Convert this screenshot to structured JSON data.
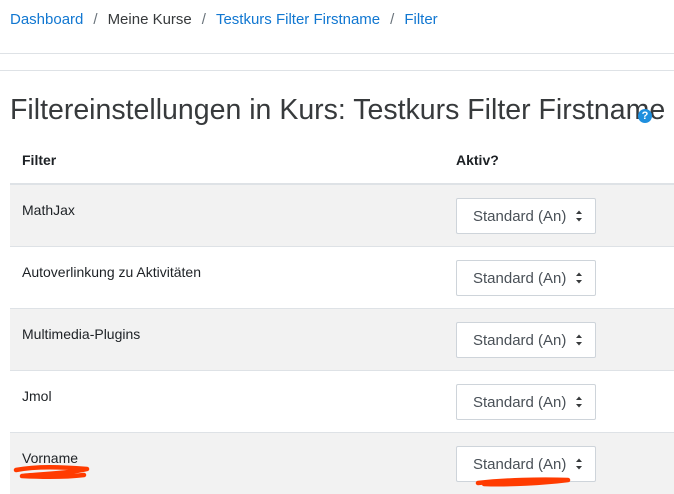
{
  "breadcrumb": {
    "items": [
      {
        "label": "Dashboard",
        "link": true
      },
      {
        "label": "Meine Kurse",
        "link": false
      },
      {
        "label": "Testkurs Filter Firstname",
        "link": true
      },
      {
        "label": "Filter",
        "link": true
      }
    ],
    "separator": "/"
  },
  "page_title": "Filtereinstellungen in Kurs: Testkurs Filter Firstname",
  "help_icon": "question-circle-icon",
  "table": {
    "headers": {
      "filter": "Filter",
      "active": "Aktiv?"
    },
    "rows": [
      {
        "name": "MathJax",
        "value": "Standard (An)"
      },
      {
        "name": "Autoverlinkung zu Aktivitäten",
        "value": "Standard (An)"
      },
      {
        "name": "Multimedia-Plugins",
        "value": "Standard (An)"
      },
      {
        "name": "Jmol",
        "value": "Standard (An)"
      },
      {
        "name": "Vorname",
        "value": "Standard (An)"
      }
    ]
  },
  "colors": {
    "link": "#1177d1",
    "annotation": "#ff3b00",
    "row_shade": "#f2f2f2"
  }
}
